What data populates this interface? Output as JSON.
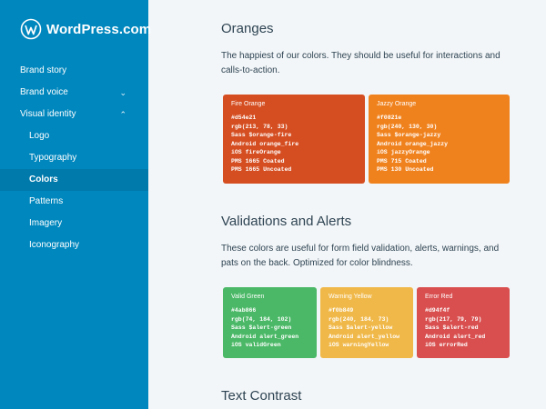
{
  "brand": {
    "name": "WordPress.com",
    "logo_icon": "wordpress-logo-icon"
  },
  "sidebar": {
    "items": [
      {
        "label": "Brand story",
        "chevron": ""
      },
      {
        "label": "Brand voice",
        "chevron": "⌄"
      },
      {
        "label": "Visual identity",
        "chevron": "⌃"
      },
      {
        "label": "Logo"
      },
      {
        "label": "Typography"
      },
      {
        "label": "Colors"
      },
      {
        "label": "Patterns"
      },
      {
        "label": "Imagery"
      },
      {
        "label": "Iconography"
      }
    ],
    "active": "Colors"
  },
  "sections": {
    "oranges": {
      "title": "Oranges",
      "description": "The happiest of our colors. They should be useful for interactions and calls-to-action."
    },
    "validations": {
      "title": "Validations and Alerts",
      "description": "These colors are useful for form field validation, alerts, warnings, and pats on the back. Optimized for color blindness."
    },
    "contrast": {
      "title": "Text Contrast"
    }
  },
  "swatches": {
    "fire_orange": {
      "name": "Fire Orange",
      "color": "#d54e21",
      "lines": [
        {
          "k": "",
          "v": "#d54e21"
        },
        {
          "k": "",
          "v": "rgb(213, 78, 33)"
        },
        {
          "k": "Sass",
          "v": "$orange-fire"
        },
        {
          "k": "Android",
          "v": "orange_fire"
        },
        {
          "k": "iOS",
          "v": "fireOrange"
        },
        {
          "k": "PMS",
          "v": "1665 Coated"
        },
        {
          "k": "PMS",
          "v": "1665 Uncoated"
        }
      ]
    },
    "jazzy_orange": {
      "name": "Jazzy Orange",
      "color": "#f0821e",
      "lines": [
        {
          "k": "",
          "v": "#f0821e"
        },
        {
          "k": "",
          "v": "rgb(240, 130, 30)"
        },
        {
          "k": "Sass",
          "v": "$orange-jazzy"
        },
        {
          "k": "Android",
          "v": "orange_jazzy"
        },
        {
          "k": "iOS",
          "v": "jazzyOrange"
        },
        {
          "k": "PMS",
          "v": "715 Coated"
        },
        {
          "k": "PMS",
          "v": "130 Uncoated"
        }
      ]
    },
    "valid_green": {
      "name": "Valid Green",
      "color": "#4ab866",
      "lines": [
        {
          "k": "",
          "v": "#4ab866"
        },
        {
          "k": "",
          "v": "rgb(74, 184, 102)"
        },
        {
          "k": "Sass",
          "v": "$alert-green"
        },
        {
          "k": "Android",
          "v": "alert_green"
        },
        {
          "k": "iOS",
          "v": "validGreen"
        }
      ]
    },
    "warning_yellow": {
      "name": "Warning Yellow",
      "color": "#f0b849",
      "lines": [
        {
          "k": "",
          "v": "#f0b849"
        },
        {
          "k": "",
          "v": "rgb(240, 184, 73)"
        },
        {
          "k": "Sass",
          "v": "$alert-yellow"
        },
        {
          "k": "Android",
          "v": "alert_yellow"
        },
        {
          "k": "iOS",
          "v": "warningYellow"
        }
      ]
    },
    "error_red": {
      "name": "Error Red",
      "color": "#d94f4f",
      "lines": [
        {
          "k": "",
          "v": "#d94f4f"
        },
        {
          "k": "",
          "v": "rgb(217, 79, 79)"
        },
        {
          "k": "Sass",
          "v": "$alert-red"
        },
        {
          "k": "Android",
          "v": "alert_red"
        },
        {
          "k": "iOS",
          "v": "errorRed"
        }
      ]
    }
  }
}
